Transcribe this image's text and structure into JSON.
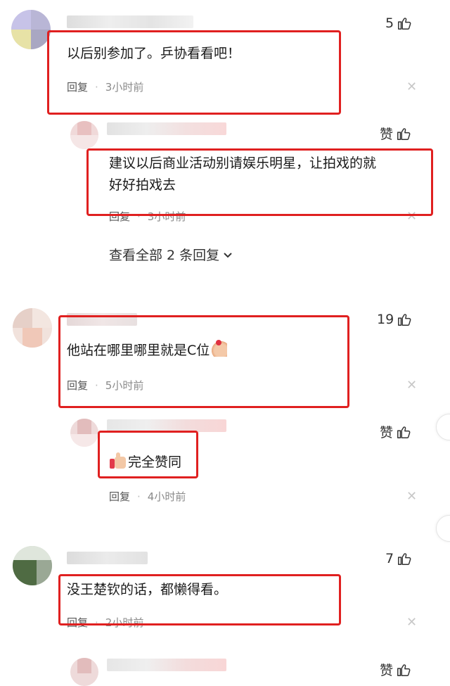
{
  "comments": [
    {
      "likes": "5",
      "text": "以后别参加了。乒协看看吧！",
      "reply_label": "回复",
      "time": "3小时前",
      "sub": {
        "like_label": "赞",
        "text_line1": "建议以后商业活动别请娱乐明星，让拍戏的就",
        "text_line2": "好好拍戏去",
        "reply_label": "回复",
        "time": "3小时前"
      },
      "view_all": "查看全部 2 条回复"
    },
    {
      "likes": "19",
      "text": "他站在哪里哪里就是C位",
      "reply_label": "回复",
      "time": "5小时前",
      "sub": {
        "like_label": "赞",
        "text": "完全赞同",
        "reply_label": "回复",
        "time": "4小时前"
      }
    },
    {
      "likes": "7",
      "text": "没王楚钦的话，都懒得看。",
      "reply_label": "回复",
      "time": "2小时前",
      "sub": {
        "like_label": "赞"
      }
    }
  ],
  "icons": {
    "like": "thumbs-up-icon",
    "close": "close-icon",
    "chevron": "chevron-down-icon"
  },
  "colors": {
    "highlight_box": "#e02020",
    "meta_text": "#8a8a8a"
  }
}
